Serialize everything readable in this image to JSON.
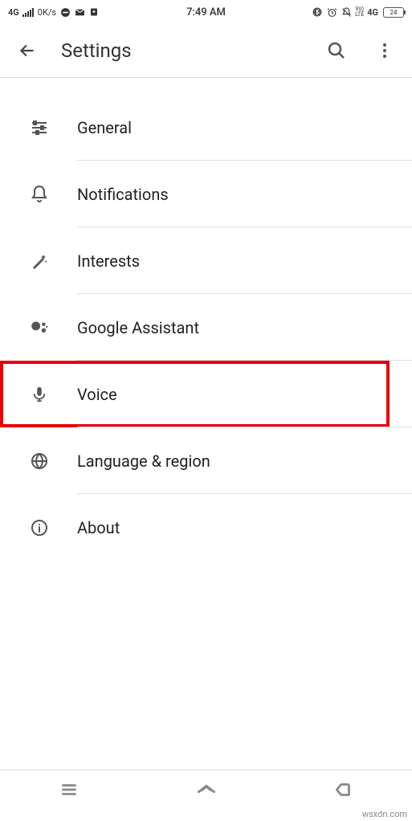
{
  "statusBar": {
    "net4g": "4G",
    "dataRate": "0K/s",
    "time": "7:49 AM",
    "volte_top": "Vo)",
    "volte_bot": "LTE",
    "right4g": "4G",
    "battery": "24"
  },
  "header": {
    "title": "Settings"
  },
  "items": {
    "general": "General",
    "notifications": "Notifications",
    "interests": "Interests",
    "assistant": "Google Assistant",
    "voice": "Voice",
    "language": "Language & region",
    "about": "About"
  },
  "watermark": "wsxdn.com"
}
